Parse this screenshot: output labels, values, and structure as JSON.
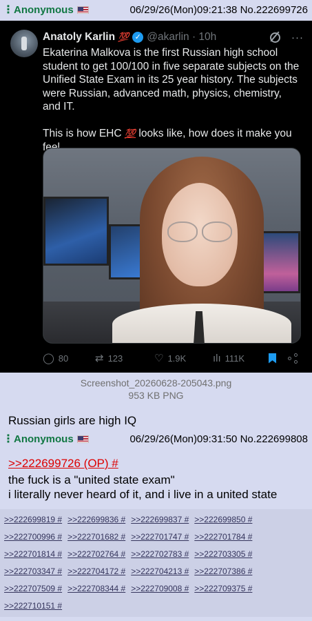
{
  "op": {
    "header": {
      "name": "Anonymous",
      "datetime": "06/29/26(Mon)09:21:38",
      "post_no": "No.222699726"
    },
    "tweet": {
      "author_name": "Anatoly Karlin",
      "author_badge": "💯",
      "handle_time": "@akarlin · 10h",
      "paragraph1": "Ekaterina Malkova is the first Russian high school student to get 100/100 in five separate subjects on the Unified State Exam in its 25 year history. The subjects were Russian, advanced math, physics, chemistry, and IT.",
      "paragraph2_before": "This is how EHC",
      "paragraph2_emoji": "💯",
      "paragraph2_after": "looks like, how does it make you feel.",
      "replies": "80",
      "retweets": "123",
      "likes": "1.9K",
      "views": "111K",
      "accent_color": "#1d9bf0"
    },
    "file": {
      "name": "Screenshot_20260628-205043.png",
      "size": "953 KB PNG"
    },
    "comment": "Russian girls are high IQ"
  },
  "reply": {
    "header": {
      "name": "Anonymous",
      "datetime": "06/29/26(Mon)09:31:50",
      "post_no": "No.222699808"
    },
    "quote": ">>222699726 (OP) #",
    "line1": "the fuck is a \"united state exam\"",
    "line2": "i literally never heard of it, and i live in a united state"
  },
  "backlinks": [
    [
      ">>222699819 #",
      ">>222699836 #",
      ">>222699837 #",
      ">>222699850 #"
    ],
    [
      ">>222700996 #",
      ">>222701682 #",
      ">>222701747 #",
      ">>222701784 #"
    ],
    [
      ">>222701814 #",
      ">>222702764 #",
      ">>222702783 #",
      ">>222703305 #"
    ],
    [
      ">>222703347 #",
      ">>222704172 #",
      ">>222704213 #",
      ">>222707386 #"
    ],
    [
      ">>222707509 #",
      ">>222708344 #",
      ">>222709008 #",
      ">>222709375 #"
    ],
    [
      ">>222710151 #"
    ]
  ],
  "colors": {
    "name_green": "#117743",
    "quote_red": "#dd0000",
    "link_blue": "#34345c",
    "board_bg": "#d6daf0"
  }
}
